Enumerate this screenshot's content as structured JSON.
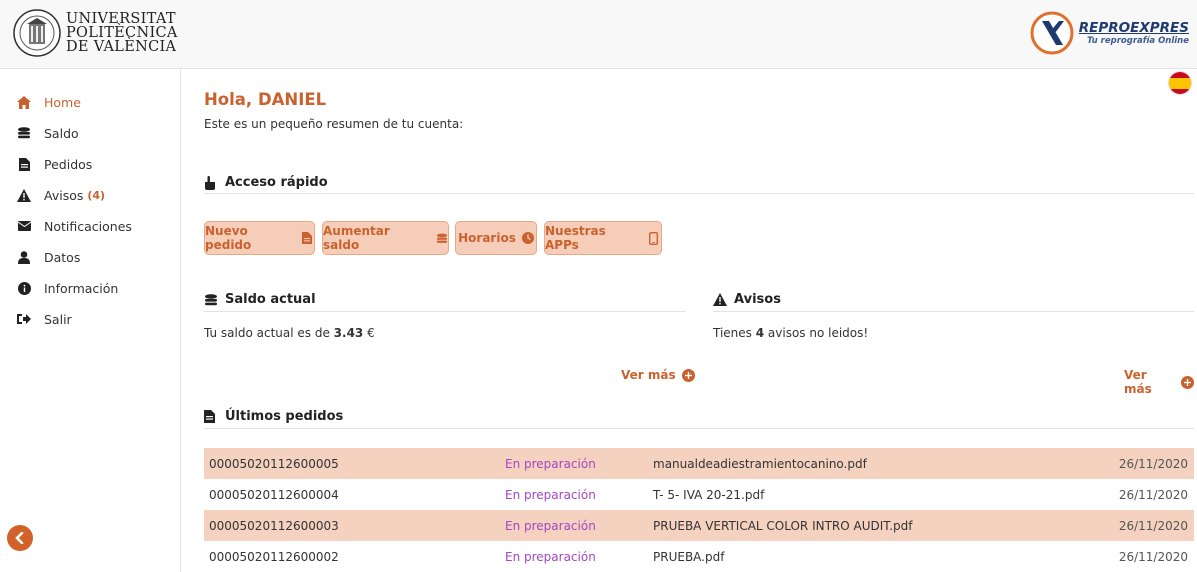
{
  "header": {
    "university": [
      "UNIVERSITAT",
      "POLITÈCNICA",
      "DE VALÈNCIA"
    ],
    "brand_name": "REPROEXPRES",
    "brand_tagline": "Tu reprografía Online"
  },
  "sidebar": {
    "items": [
      {
        "label": "Home",
        "icon": "home-icon",
        "active": true
      },
      {
        "label": "Saldo",
        "icon": "coins-icon"
      },
      {
        "label": "Pedidos",
        "icon": "file-icon"
      },
      {
        "label": "Avisos",
        "icon": "warning-icon",
        "count": "(4)"
      },
      {
        "label": "Notificaciones",
        "icon": "envelope-icon"
      },
      {
        "label": "Datos",
        "icon": "user-icon"
      },
      {
        "label": "Información",
        "icon": "info-icon"
      },
      {
        "label": "Salir",
        "icon": "sign-out-icon"
      }
    ]
  },
  "main": {
    "greeting": "Hola, DANIEL",
    "summary": "Este es un pequeño resumen de tu cuenta:",
    "quick_access": {
      "title": "Acceso rápido",
      "buttons": [
        {
          "label": "Nuevo pedido",
          "icon": "file-icon"
        },
        {
          "label": "Aumentar saldo",
          "icon": "coins-icon"
        },
        {
          "label": "Horarios",
          "icon": "clock-icon"
        },
        {
          "label": "Nuestras APPs",
          "icon": "mobile-icon"
        }
      ]
    },
    "balance": {
      "title": "Saldo actual",
      "text_prefix": "Tu saldo actual es de ",
      "amount": "3.43",
      "text_suffix": " €",
      "more": "Ver más"
    },
    "notices": {
      "title": "Avisos",
      "text_prefix": "Tienes ",
      "count": "4",
      "text_suffix": " avisos no leidos!",
      "more": "Ver más"
    },
    "orders": {
      "title": "Últimos pedidos",
      "rows": [
        {
          "id": "00005020112600005",
          "status": "En preparación",
          "file": "manualdeadiestramientocanino.pdf",
          "date": "26/11/2020"
        },
        {
          "id": "00005020112600004",
          "status": "En preparación",
          "file": "T- 5- IVA 20-21.pdf",
          "date": "26/11/2020"
        },
        {
          "id": "00005020112600003",
          "status": "En preparación",
          "file": "PRUEBA VERTICAL COLOR INTRO AUDIT.pdf",
          "date": "26/11/2020"
        },
        {
          "id": "00005020112600002",
          "status": "En preparación",
          "file": "PRUEBA.pdf",
          "date": "26/11/2020"
        }
      ]
    }
  },
  "colors": {
    "accent": "#c9622f",
    "button_bg": "#f5cdb8",
    "row_shade": "#f5d2c0",
    "status": "#a347c4",
    "brand_blue": "#1f3a6e"
  }
}
